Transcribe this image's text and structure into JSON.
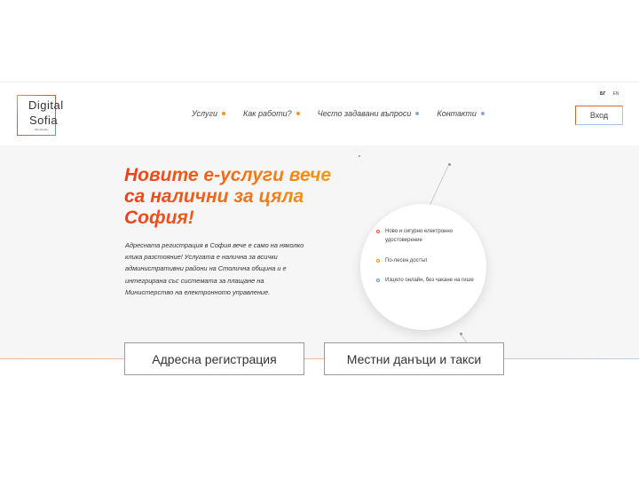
{
  "logo": {
    "line1": "Digital",
    "line2": "Sofia",
    "tiny": "Municipality"
  },
  "nav": [
    {
      "label": "Услуги",
      "dot_color": "#f7941d"
    },
    {
      "label": "Как работи?",
      "dot_color": "#f7941d"
    },
    {
      "label": "Често задавани въпроси",
      "dot_color": "#8aa8d0"
    },
    {
      "label": "Контакти",
      "dot_color": "#8aa8d0"
    }
  ],
  "lang": {
    "bg": "БГ",
    "en": "EN"
  },
  "login_label": "Вход",
  "hero": {
    "title": "Новите е-услуги вече са налични за цяла София!",
    "description": "Адресната регистрация в София вече е само на няколко клика разстояние! Услугата е налична за всички административни райони на Столична община и е интегрирана със системата за плащане на Министерство на електронното управление.",
    "features": [
      {
        "text": "Ново и сигурно електронно удостоверение",
        "color": "#e9542a"
      },
      {
        "text": "По-лесен достъп",
        "color": "#f7941d"
      },
      {
        "text": "Изцяло онлайн, без чакане на гише",
        "color": "#5b8fd0"
      }
    ]
  },
  "buttons": {
    "address": "Адресна регистрация",
    "taxes": "Местни данъци и такси"
  },
  "colors": {
    "accent_orange": "#e8401c",
    "accent_yellow": "#f59b16",
    "accent_blue": "#5b8fd0"
  }
}
